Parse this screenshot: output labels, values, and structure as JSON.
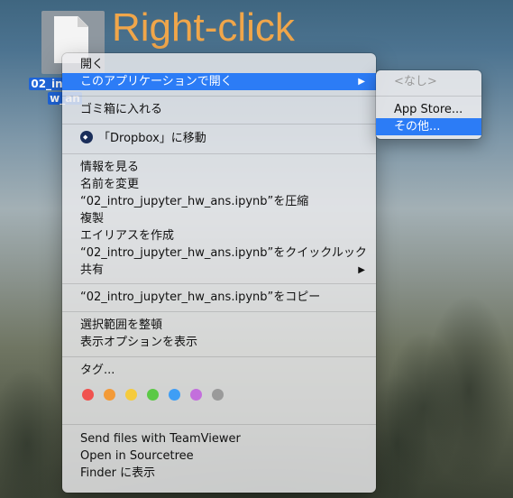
{
  "desktop": {
    "file_label_line1": "02_intro",
    "file_label_line2": "w_an",
    "annotation": "Right-click"
  },
  "context_menu": {
    "open": "開く",
    "open_with": "このアプリケーションで開く",
    "move_to_trash": "ゴミ箱に入れる",
    "dropbox_move": "「Dropbox」に移動",
    "get_info": "情報を見る",
    "rename": "名前を変更",
    "compress": "“02_intro_jupyter_hw_ans.ipynb”を圧縮",
    "duplicate": "複製",
    "make_alias": "エイリアスを作成",
    "quick_look": "“02_intro_jupyter_hw_ans.ipynb”をクイックルック",
    "share": "共有",
    "copy": "“02_intro_jupyter_hw_ans.ipynb”をコピー",
    "clean_up": "選択範囲を整頓",
    "view_options": "表示オプションを表示",
    "tags": "タグ...",
    "tag_colors": [
      "#f0524f",
      "#f39a37",
      "#f5cb3c",
      "#5bc946",
      "#3f9ef5",
      "#c36fdc",
      "#9a9a9a"
    ],
    "teamviewer": "Send files with TeamViewer",
    "sourcetree": "Open in Sourcetree",
    "finder_show": "Finder に表示"
  },
  "submenu": {
    "none": "<なし>",
    "app_store": "App Store...",
    "other": "その他..."
  }
}
